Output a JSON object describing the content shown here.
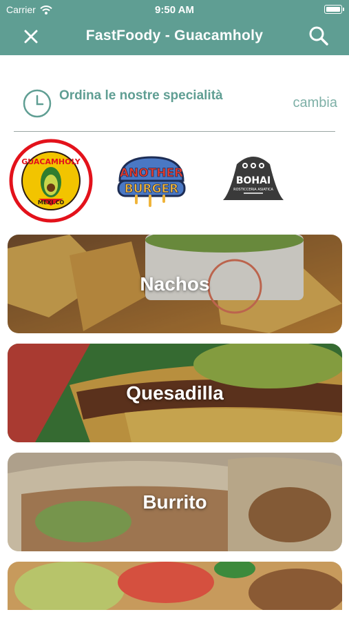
{
  "status_bar": {
    "carrier": "Carrier",
    "time": "9:50 AM"
  },
  "header": {
    "title": "FastFoody - Guacamholy"
  },
  "order": {
    "title": "Ordina le nostre specialità",
    "change_label": "cambia"
  },
  "brands": [
    {
      "name": "Guacamholy",
      "logo_text_top": "GUACAMHOLY",
      "logo_text_bottom": "MEXI.CO",
      "selected": true
    },
    {
      "name": "Another Burger",
      "logo_line_1": "ANOTHER",
      "logo_line_2": "BURGER",
      "selected": false
    },
    {
      "name": "Bohai",
      "logo_text": "BOHAI",
      "logo_subtext": "ROSTICCERIA ASIATICA",
      "selected": false
    }
  ],
  "categories": [
    {
      "label": "Nachos"
    },
    {
      "label": "Quesadilla"
    },
    {
      "label": "Burrito"
    },
    {
      "label": ""
    }
  ],
  "colors": {
    "header": "#5f9e93",
    "accent_text": "#5f9e93",
    "link": "#7eb0a7",
    "selected_ring": "#e3121b"
  }
}
